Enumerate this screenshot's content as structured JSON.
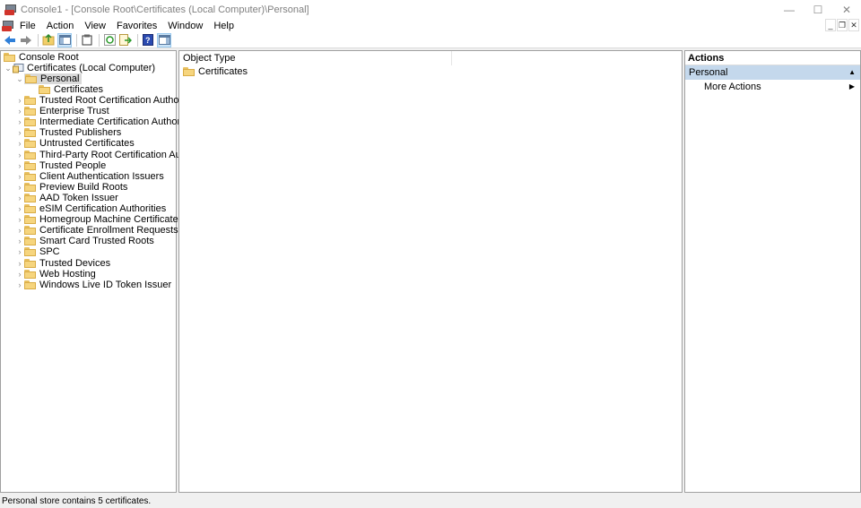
{
  "window": {
    "title": "Console1 - [Console Root\\Certificates (Local Computer)\\Personal]",
    "controls": {
      "minimize": "—",
      "maximize": "☐",
      "close": "✕"
    }
  },
  "menubar": {
    "items": [
      "File",
      "Action",
      "View",
      "Favorites",
      "Window",
      "Help"
    ],
    "mdi_controls": {
      "minimize": "_",
      "restore": "❐",
      "close": "✕"
    }
  },
  "toolbar": {
    "buttons": [
      "back-icon",
      "forward-icon",
      "up-folder-icon",
      "show-hide-console-tree-icon",
      "properties-icon",
      "refresh-icon",
      "export-list-icon",
      "help-icon",
      "show-hide-action-pane-icon"
    ]
  },
  "tree": {
    "root": "Console Root",
    "snapin": "Certificates (Local Computer)",
    "selected": "Personal",
    "selected_child": "Certificates",
    "items": [
      "Trusted Root Certification Authorities",
      "Enterprise Trust",
      "Intermediate Certification Authorities",
      "Trusted Publishers",
      "Untrusted Certificates",
      "Third-Party Root Certification Authorities",
      "Trusted People",
      "Client Authentication Issuers",
      "Preview Build Roots",
      "AAD Token Issuer",
      "eSIM Certification Authorities",
      "Homegroup Machine Certificates",
      "Certificate Enrollment Requests",
      "Smart Card Trusted Roots",
      "SPC",
      "Trusted Devices",
      "Web Hosting",
      "Windows Live ID Token Issuer"
    ]
  },
  "list": {
    "column": "Object Type",
    "rows": [
      "Certificates"
    ]
  },
  "actions": {
    "header": "Actions",
    "section": "Personal",
    "items": [
      "More Actions"
    ]
  },
  "status": "Personal store contains 5 certificates."
}
